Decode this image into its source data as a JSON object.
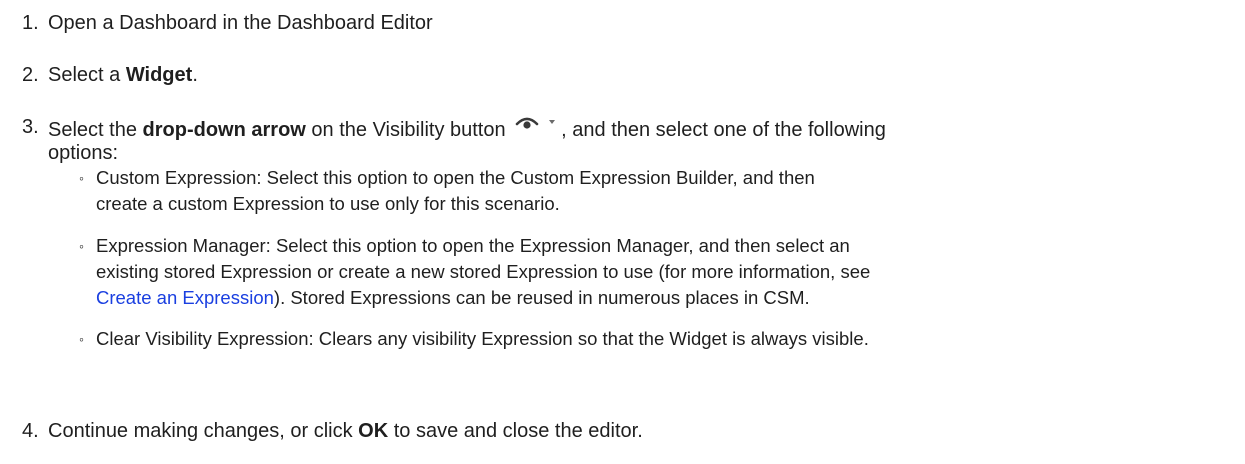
{
  "steps": [
    {
      "number": "1.",
      "text": "Open a Dashboard in the Dashboard Editor"
    },
    {
      "number": "2.",
      "pre": "Select a ",
      "bold": "Widget",
      "post": "."
    },
    {
      "number": "3.",
      "pre": "Select the ",
      "bold": "drop-down arrow",
      "mid": " on the Visibility button ",
      "post": ", and then select one of the following",
      "line2": "options:",
      "options": [
        {
          "line1": "Custom Expression: Select this option to open the Custom Expression Builder, and then",
          "line2": "create a custom Expression to use only for this scenario."
        },
        {
          "line1": "Expression Manager: Select this option to open the Expression Manager, and then select an",
          "line2": "existing stored Expression or create a new stored Expression to use (for more information, see",
          "link": "Create an Expression",
          "line3_post": "). Stored Expressions can be reused in numerous places in CSM."
        },
        {
          "line1": "Clear Visibility Expression: Clears any visibility Expression so that the Widget is always visible."
        }
      ],
      "icon": "visibility-eye-icon"
    },
    {
      "number": "4.",
      "pre": "Continue making changes, or click ",
      "bold": "OK",
      "post": " to save and close the editor."
    }
  ],
  "colors": {
    "text": "#1f1f1f",
    "link": "#1a3fe0",
    "icon": "#3a3a3a"
  },
  "bullet_char": "◦"
}
